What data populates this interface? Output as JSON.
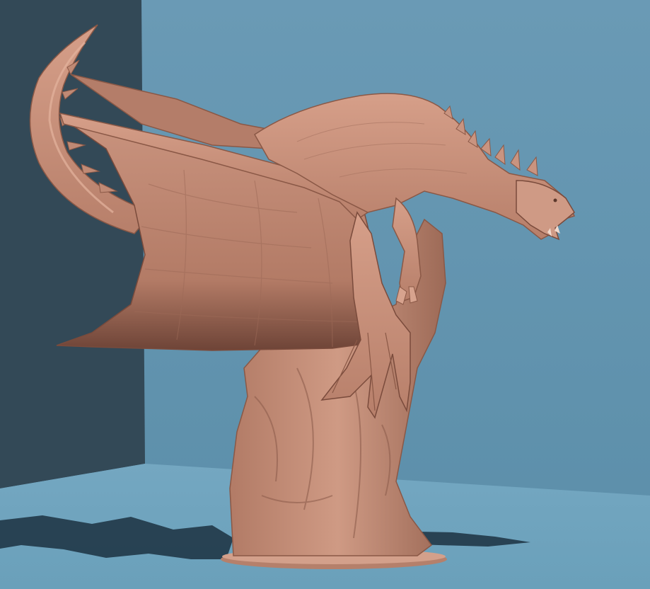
{
  "scene": {
    "subject_icon": "dragon-sculpture-icon",
    "colors": {
      "left_wall": "#334957",
      "back_wall": "#6596b2",
      "floor": "#6fa3bd",
      "shadow": "#213848",
      "clay": "#c58f7a",
      "clay_dark": "#8e5d4d",
      "clay_light": "#e0ad97"
    }
  }
}
